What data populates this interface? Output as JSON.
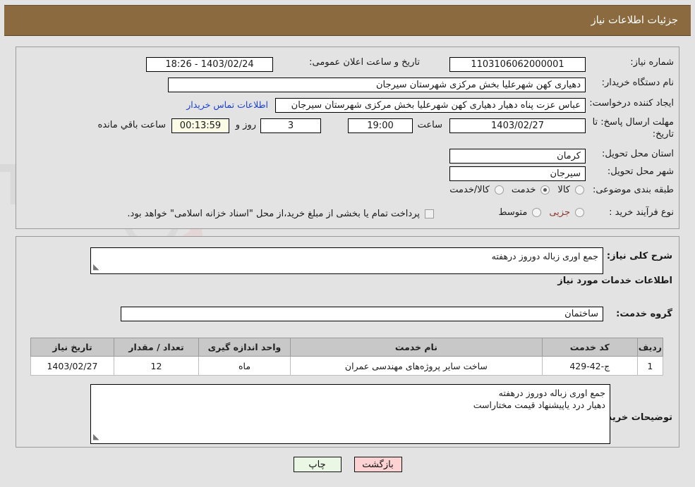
{
  "header": {
    "title": "جزئیات اطلاعات نیاز"
  },
  "top": {
    "need_number_label": "شماره نیاز:",
    "need_number_value": "1103106062000001",
    "announce_label": "تاریخ و ساعت اعلان عمومی:",
    "announce_value": "1403/02/24 - 18:26",
    "buyer_org_label": "نام دستگاه خریدار:",
    "buyer_org_value": "دهیاری کهن شهرعلیا بخش مرکزی شهرستان سیرجان",
    "creator_label": "ایجاد کننده درخواست:",
    "creator_value": "عباس عزت پناه دهیار دهیاری کهن شهرعلیا بخش مرکزی شهرستان سیرجان",
    "contact_link": "اطلاعات تماس خریدار",
    "deadline_label": "مهلت ارسال پاسخ: تا تاریخ:",
    "deadline_date": "1403/02/27",
    "hour_label": "ساعت",
    "deadline_hour": "19:00",
    "days_value": "3",
    "days_label": "روز و",
    "countdown_value": "00:13:59",
    "remaining_label": "ساعت باقي مانده",
    "province_label": "استان محل تحویل:",
    "province_value": "کرمان",
    "city_label": "شهر محل تحویل:",
    "city_value": "سیرجان",
    "category_label": "طبقه بندی موضوعی:",
    "category_options": [
      {
        "label": "کالا",
        "selected": false
      },
      {
        "label": "خدمت",
        "selected": true
      },
      {
        "label": "کالا/خدمت",
        "selected": false
      }
    ],
    "process_label": "نوع فرآیند خرید :",
    "process_options": [
      {
        "label": "جزیی",
        "selected": false
      },
      {
        "label": "متوسط",
        "selected": false
      }
    ],
    "treasury_checkbox_label": "پرداخت تمام یا بخشی از مبلغ خرید،از محل \"اسناد خزانه اسلامی\" خواهد بود."
  },
  "bottom": {
    "general_desc_label": "شرح کلی نیاز:",
    "general_desc_value": "جمع اوری زباله دوروز درهفته",
    "services_info_label": "اطلاعات خدمات مورد نیاز",
    "service_group_label": "گروه خدمت:",
    "service_group_value": "ساختمان",
    "buyer_notes_label": "توضیحات خریدار:",
    "buyer_notes_line1": "جمع اوری زباله دوروز درهفته",
    "buyer_notes_line2": "دهیار درد یاپیشنهاد قیمت مختاراست"
  },
  "table": {
    "columns": [
      "ردیف",
      "کد خدمت",
      "نام خدمت",
      "واحد اندازه گیری",
      "تعداد / مقدار",
      "تاریخ نیاز"
    ],
    "rows": [
      {
        "radif": "1",
        "code": "ج-42-429",
        "name": "ساخت سایر پروژه‌های مهندسی عمران",
        "unit": "ماه",
        "qty": "12",
        "date": "1403/02/27"
      }
    ]
  },
  "footer": {
    "print_label": "چاپ",
    "back_label": "بازگشت"
  },
  "colors": {
    "header_bg": "#8c6a3f",
    "page_bg": "#e3e3e3",
    "link": "#1a3fd0",
    "accent_text": "#8a3b2e",
    "table_header_bg": "#c8c8c8",
    "back_btn_bg": "#fcd2d2",
    "print_btn_bg": "#e9f7e4",
    "cream_field_bg": "#fbfbe6"
  }
}
